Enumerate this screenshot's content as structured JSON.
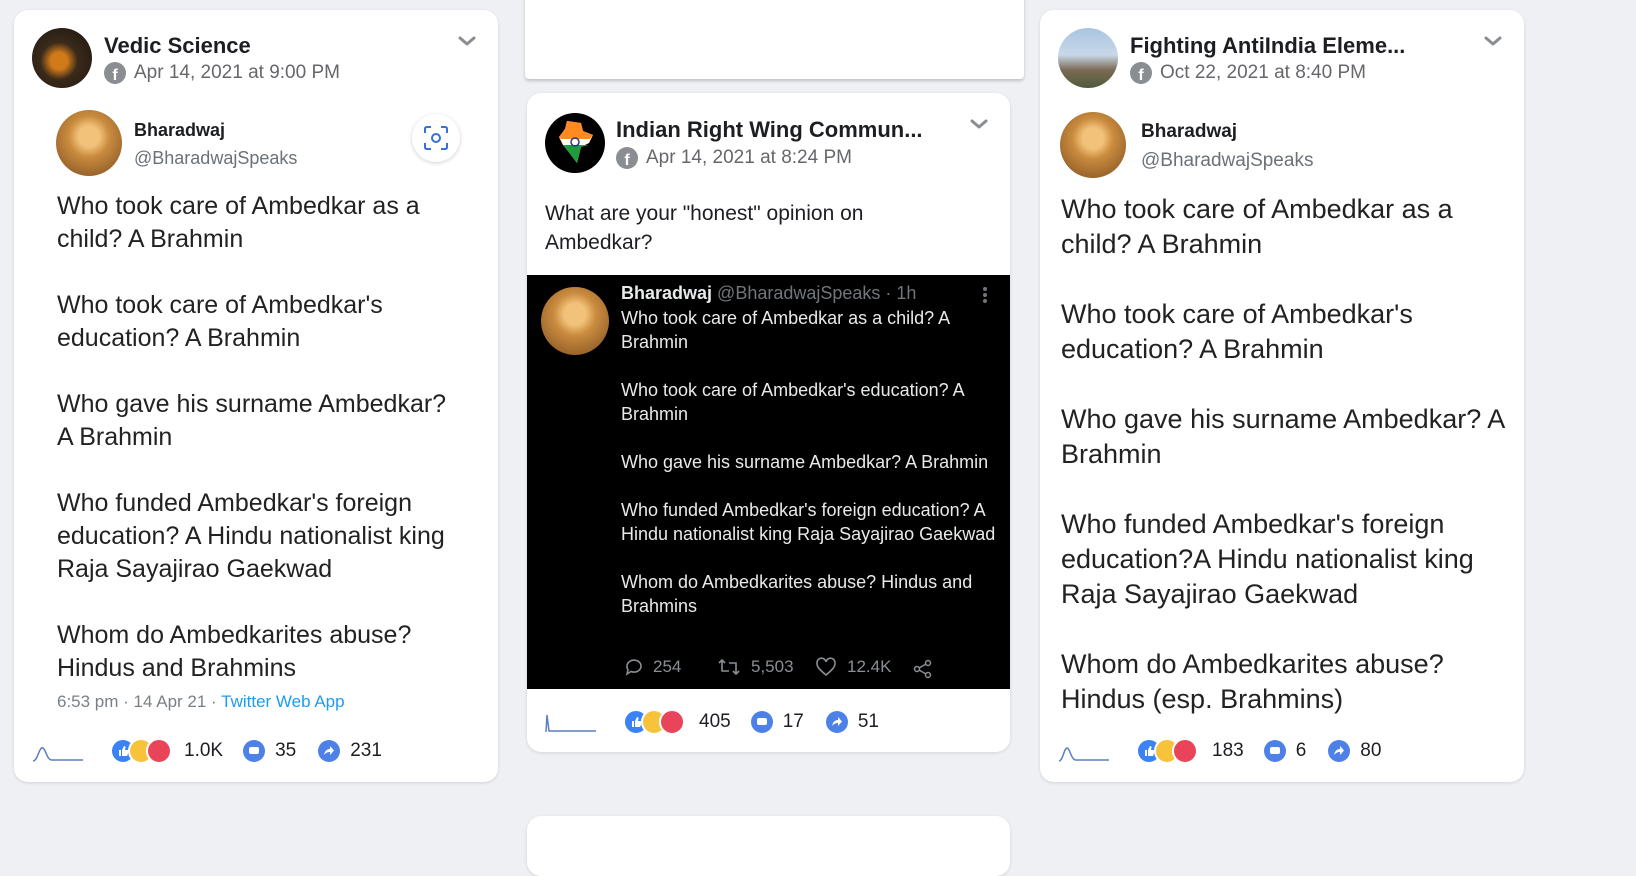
{
  "posts": [
    {
      "page_name": "Vedic Science",
      "date": "Apr 14, 2021 at 9:00 PM",
      "tweet": {
        "name": "Bharadwaj",
        "handle": "@BharadwajSpeaks",
        "lines": [
          "Who took care of Ambedkar as a child? A Brahmin",
          "Who took care of Ambedkar's education? A Brahmin",
          "Who gave his surname Ambedkar? A Brahmin",
          "Who funded Ambedkar's foreign education? A Hindu nationalist king Raja Sayajirao Gaekwad",
          "Whom do Ambedkarites abuse? Hindus and Brahmins"
        ],
        "timestamp": "6:53 pm · 14 Apr 21 · ",
        "via": "Twitter Web App"
      },
      "reactions": "1.0K",
      "comments": "35",
      "shares": "231"
    },
    {
      "page_name": "Indian Right Wing Commun...",
      "date": "Apr 14, 2021 at 8:24 PM",
      "caption": "What are your \"honest\" opinion on Ambedkar?",
      "tweet": {
        "name": "Bharadwaj",
        "handle": "@BharadwajSpeaks · 1h",
        "lines": [
          "Who took care of Ambedkar as a child? A Brahmin",
          "Who took care of Ambedkar's education? A Brahmin",
          "Who gave his surname Ambedkar? A Brahmin",
          "Who funded Ambedkar's foreign education? A Hindu nationalist king Raja Sayajirao Gaekwad",
          "Whom do Ambedkarites abuse? Hindus and Brahmins"
        ],
        "replies": "254",
        "retweets": "5,503",
        "likes": "12.4K"
      },
      "reactions": "405",
      "comments": "17",
      "shares": "51"
    },
    {
      "page_name": "Fighting AntiIndia Eleme...",
      "date": "Oct 22, 2021 at 8:40 PM",
      "tweet": {
        "name": "Bharadwaj",
        "handle": "@BharadwajSpeaks",
        "lines": [
          "Who took care of Ambedkar as a child? A Brahmin",
          "Who took care of Ambedkar's education? A Brahmin",
          "Who gave his surname Ambedkar? A Brahmin",
          "Who funded Ambedkar's foreign education?A Hindu nationalist king Raja Sayajirao Gaekwad",
          "Whom do Ambedkarites abuse? Hindus (esp. Brahmins)"
        ]
      },
      "reactions": "183",
      "comments": "6",
      "shares": "80"
    }
  ],
  "colors": {
    "accent": "#4e81e8",
    "link": "#1d9bf0",
    "muted": "#65676b"
  }
}
